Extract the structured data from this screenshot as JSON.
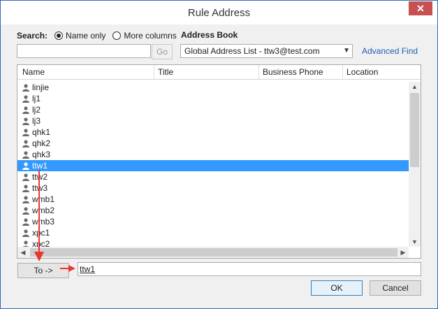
{
  "window": {
    "title": "Rule Address",
    "close_glyph": "✕"
  },
  "search": {
    "label": "Search:",
    "options": [
      {
        "label": "Name only",
        "selected": true
      },
      {
        "label": "More columns",
        "selected": false
      }
    ],
    "input_value": "",
    "go_label": "Go"
  },
  "address_book": {
    "label": "Address Book",
    "selected": "Global Address List - ttw3@test.com",
    "advanced_find": "Advanced Find"
  },
  "list": {
    "columns": [
      "Name",
      "Title",
      "Business Phone",
      "Location"
    ],
    "rows": [
      {
        "name": "linjie"
      },
      {
        "name": "lj1"
      },
      {
        "name": "lj2"
      },
      {
        "name": "lj3"
      },
      {
        "name": "qhk1"
      },
      {
        "name": "qhk2"
      },
      {
        "name": "qhk3"
      },
      {
        "name": "ttw1",
        "selected": true
      },
      {
        "name": "ttw2"
      },
      {
        "name": "ttw3"
      },
      {
        "name": "wmb1"
      },
      {
        "name": "wmb2"
      },
      {
        "name": "wmb3"
      },
      {
        "name": "xpc1"
      },
      {
        "name": "xpc2"
      }
    ]
  },
  "to": {
    "button_label": "To ->",
    "value": "ttw1"
  },
  "buttons": {
    "ok": "OK",
    "cancel": "Cancel"
  },
  "colors": {
    "selection": "#3399ff",
    "link": "#1f5fb4",
    "annotation": "#e8382e"
  }
}
